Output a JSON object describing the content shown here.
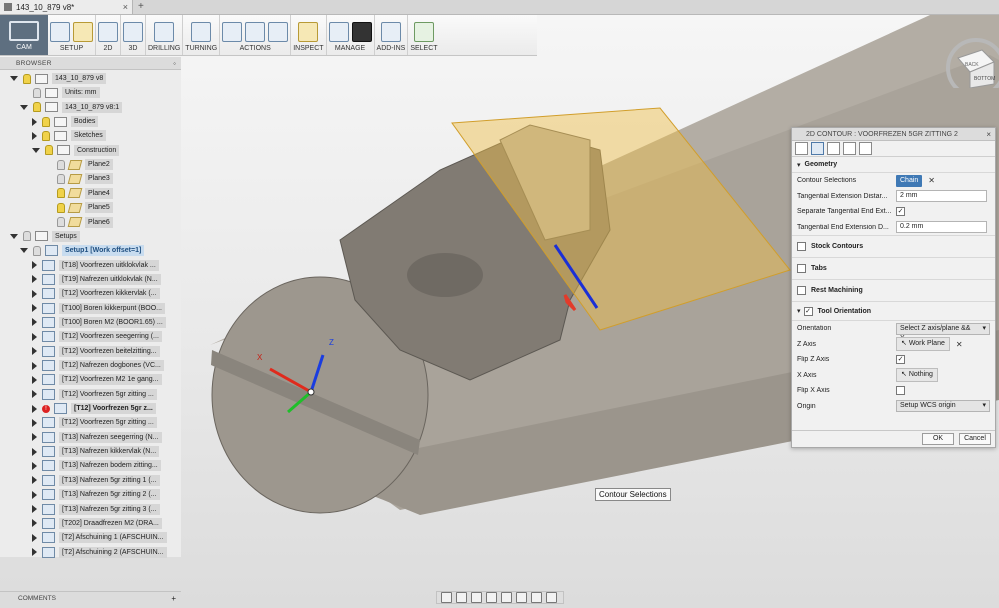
{
  "document": {
    "tab_title": "143_10_879 v8*",
    "close": "×",
    "add_tab": "+"
  },
  "toolbar": {
    "workspace": "CAM",
    "groups": [
      {
        "label": "SETUP",
        "icons": [
          "setup-icon",
          "folder-icon"
        ]
      },
      {
        "label": "2D",
        "icons": [
          "2d-pocket-icon"
        ]
      },
      {
        "label": "3D",
        "icons": [
          "3d-adaptive-icon"
        ]
      },
      {
        "label": "DRILLING",
        "icons": [
          "drill-icon"
        ]
      },
      {
        "label": "TURNING",
        "icons": [
          "turning-icon"
        ]
      },
      {
        "label": "ACTIONS",
        "icons": [
          "simulate-icon",
          "post-process-icon",
          "setup-sheet-icon"
        ]
      },
      {
        "label": "INSPECT",
        "icons": [
          "measure-icon"
        ]
      },
      {
        "label": "MANAGE",
        "icons": [
          "tool-library-icon",
          "template-icon"
        ]
      },
      {
        "label": "ADD-INS",
        "icons": [
          "scripts-icon"
        ]
      },
      {
        "label": "SELECT",
        "icons": [
          "select-icon"
        ]
      }
    ]
  },
  "browser": {
    "header": "BROWSER",
    "items": [
      {
        "label": "143_10_879 v8",
        "level": 0,
        "tri": "open",
        "bulb": true,
        "icon": "doc"
      },
      {
        "label": "Units: mm",
        "level": 1,
        "tri": "",
        "bulb": false,
        "icon": "doc"
      },
      {
        "label": "143_10_879 v8:1",
        "level": 1,
        "tri": "open",
        "bulb": true,
        "icon": "doc"
      },
      {
        "label": "Bodies",
        "level": 2,
        "tri": "closed",
        "bulb": true,
        "icon": "folder"
      },
      {
        "label": "Sketches",
        "level": 2,
        "tri": "closed",
        "bulb": true,
        "icon": "folder"
      },
      {
        "label": "Construction",
        "level": 2,
        "tri": "open",
        "bulb": true,
        "icon": "folder"
      },
      {
        "label": "Plane2",
        "level": 3,
        "tri": "",
        "bulb": false,
        "icon": "plane"
      },
      {
        "label": "Plane3",
        "level": 3,
        "tri": "",
        "bulb": false,
        "icon": "plane"
      },
      {
        "label": "Plane4",
        "level": 3,
        "tri": "",
        "bulb": true,
        "icon": "plane"
      },
      {
        "label": "Plane5",
        "level": 3,
        "tri": "",
        "bulb": true,
        "icon": "plane"
      },
      {
        "label": "Plane6",
        "level": 3,
        "tri": "",
        "bulb": false,
        "icon": "plane"
      },
      {
        "label": "Setups",
        "level": 0,
        "tri": "open",
        "bulb": false,
        "icon": "folder"
      },
      {
        "label": "Setup1 [Work offset=1]",
        "level": 1,
        "tri": "open",
        "bulb": false,
        "icon": "op",
        "selected": true
      },
      {
        "label": "[T18] Voorfrezen uitklokvlak ...",
        "level": 2,
        "tri": "closed",
        "icon": "op"
      },
      {
        "label": "[T19] Nafrezen uitklokvlak (N...",
        "level": 2,
        "tri": "closed",
        "icon": "op"
      },
      {
        "label": "[T12] Voorfrezen kikkervlak (...",
        "level": 2,
        "tri": "closed",
        "icon": "op"
      },
      {
        "label": "[T100] Boren kikkerpunt (BOO...",
        "level": 2,
        "tri": "closed",
        "icon": "op"
      },
      {
        "label": "[T100] Boren M2 (BOOR1.65) ...",
        "level": 2,
        "tri": "closed",
        "icon": "op"
      },
      {
        "label": "[T12] Voorfrezen seegerring (...",
        "level": 2,
        "tri": "closed",
        "icon": "op"
      },
      {
        "label": "[T12] Voorfrezen beitelzitting...",
        "level": 2,
        "tri": "closed",
        "icon": "op"
      },
      {
        "label": "[T12] Nafrezen dogbones (VC...",
        "level": 2,
        "tri": "closed",
        "icon": "op"
      },
      {
        "label": "[T12] Voorfrezen M2 1e gang...",
        "level": 2,
        "tri": "closed",
        "icon": "op"
      },
      {
        "label": "[T12] Voorfrezen 5gr zitting ...",
        "level": 2,
        "tri": "closed",
        "icon": "op"
      },
      {
        "label": "[T12] Voorfrezen 5gr z...",
        "level": 2,
        "tri": "closed",
        "icon": "op",
        "error": true,
        "bold": true
      },
      {
        "label": "[T12] Voorfrezen 5gr zitting ...",
        "level": 2,
        "tri": "closed",
        "icon": "op"
      },
      {
        "label": "[T13] Nafrezen seegerring (N...",
        "level": 2,
        "tri": "closed",
        "icon": "op"
      },
      {
        "label": "[T13] Nafrezen kikkervlak (N...",
        "level": 2,
        "tri": "closed",
        "icon": "op"
      },
      {
        "label": "[T13] Nafrezen bodem zitting...",
        "level": 2,
        "tri": "closed",
        "icon": "op"
      },
      {
        "label": "[T13] Nafrezen 5gr zitting 1 (...",
        "level": 2,
        "tri": "closed",
        "icon": "op"
      },
      {
        "label": "[T13] Nafrezen 5gr zitting 2 (...",
        "level": 2,
        "tri": "closed",
        "icon": "op"
      },
      {
        "label": "[T13] Nafrezen 5gr zitting 3 (...",
        "level": 2,
        "tri": "closed",
        "icon": "op"
      },
      {
        "label": "[T202] Draadfrezen M2 (DRA...",
        "level": 2,
        "tri": "closed",
        "icon": "op"
      },
      {
        "label": "[T2] Afschuining 1 (AFSCHUIN...",
        "level": 2,
        "tri": "closed",
        "icon": "op"
      },
      {
        "label": "[T2] Afschuining 2 (AFSCHUIN...",
        "level": 2,
        "tri": "closed",
        "icon": "op"
      }
    ]
  },
  "comments": {
    "label": "COMMENTS"
  },
  "panel": {
    "title": "2D CONTOUR : VOORFREZEN 5GR ZITTING 2",
    "geometry": {
      "header": "Geometry",
      "contour_label": "Contour Selections",
      "chain_label": "Chain",
      "tangential_ext_label": "Tangential Extension Distar...",
      "tangential_ext_value": "2 mm",
      "separate_ext_label": "Separate Tangential End Ext...",
      "separate_ext_checked": "✓",
      "tangential_end_label": "Tangential End Extension D...",
      "tangential_end_value": "0.2 mm"
    },
    "stock_contours": "Stock Contours",
    "tabs": "Tabs",
    "rest_machining": "Rest Machining",
    "tool_orientation": {
      "header": "Tool Orientation",
      "header_checked": "✓",
      "orientation_label": "Orientation",
      "orientation_value": "Select Z axis/plane && X...",
      "z_axis_label": "Z Axis",
      "z_axis_value": "Work Plane",
      "flip_z_label": "Flip Z Axis",
      "flip_z_checked": "✓",
      "x_axis_label": "X Axis",
      "x_axis_value": "Nothing",
      "flip_x_label": "Flip X Axis",
      "origin_label": "Origin",
      "origin_value": "Setup WCS origin"
    },
    "ok": "OK",
    "cancel": "Cancel"
  },
  "viewport": {
    "tooltip": "Contour Selections",
    "triad": {
      "x": "X",
      "z": "Z"
    },
    "viewcube": {
      "front": "BOTTOM",
      "side": "BACK"
    }
  }
}
